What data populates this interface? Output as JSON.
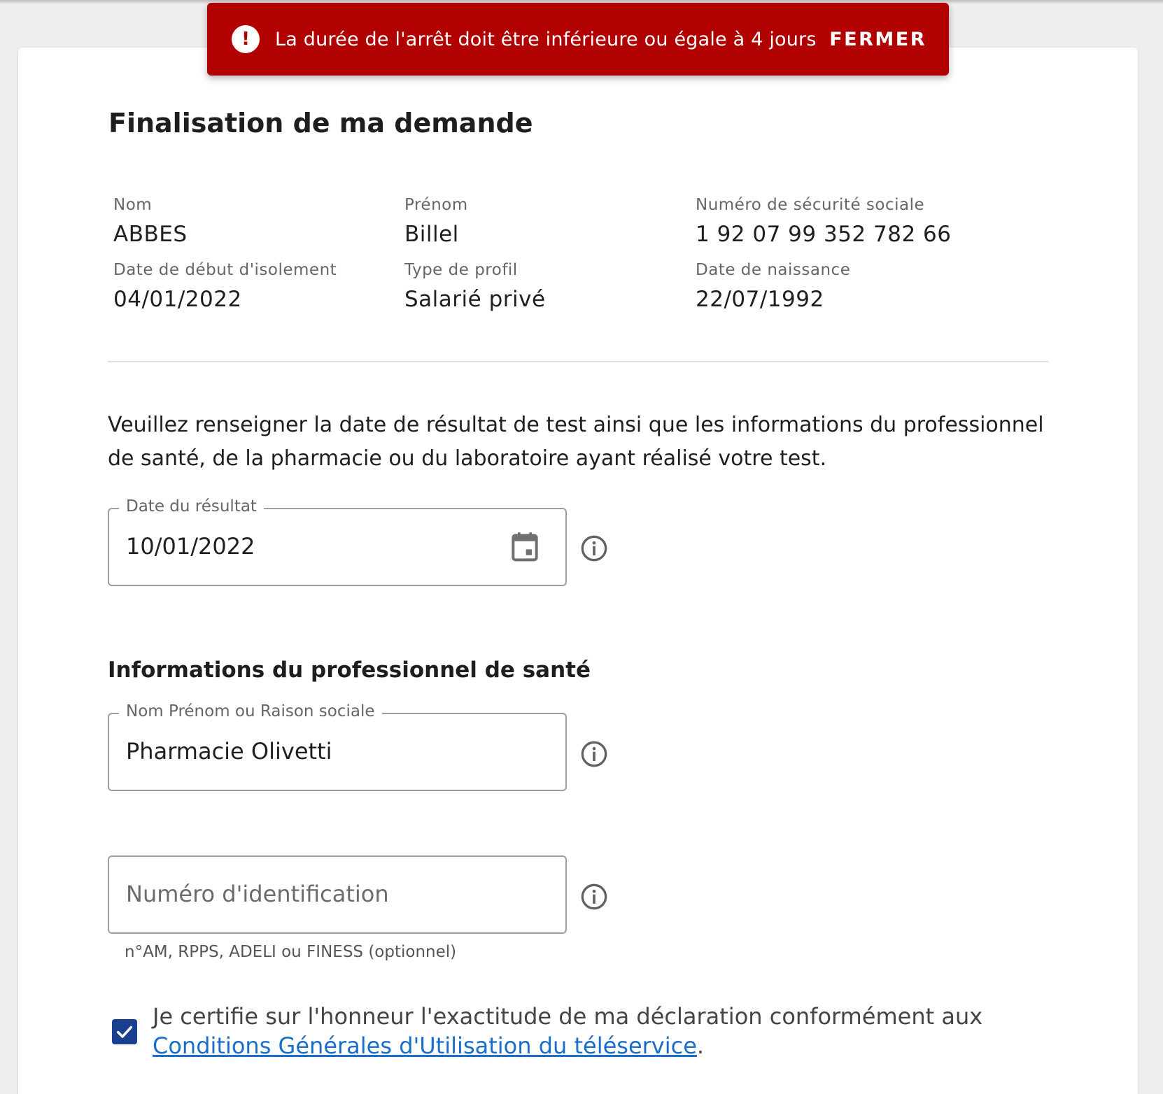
{
  "alert": {
    "message": "La durée de l'arrêt doit être inférieure ou égale à 4 jours",
    "close_label": "FERMER",
    "icon": "exclamation-icon",
    "color": "#b00000"
  },
  "title": "Finalisation de ma demande",
  "person": {
    "nom": {
      "label": "Nom",
      "value": "ABBES"
    },
    "prenom": {
      "label": "Prénom",
      "value": "Billel"
    },
    "nss": {
      "label": "Numéro de sécurité sociale",
      "value": "1 92 07 99 352 782 66"
    },
    "date_debut": {
      "label": "Date de début d'isolement",
      "value": "04/01/2022"
    },
    "profil": {
      "label": "Type de profil",
      "value": "Salarié privé"
    },
    "naissance": {
      "label": "Date de naissance",
      "value": "22/07/1992"
    }
  },
  "intro": "Veuillez renseigner la date de résultat de test ainsi que les informations du professionnel de santé, de la pharmacie ou du laboratoire ayant réalisé votre test.",
  "date_field": {
    "label": "Date du résultat",
    "value": "10/01/2022"
  },
  "section_title": "Informations du professionnel de santé",
  "name_field": {
    "label": "Nom Prénom ou Raison sociale",
    "value": "Pharmacie Olivetti"
  },
  "id_field": {
    "placeholder": "Numéro d'identification",
    "value": "",
    "helper": "n°AM, RPPS, ADELI ou FINESS (optionnel)"
  },
  "certification": {
    "checked": true,
    "text": "Je certifie sur l'honneur l'exactitude de ma déclaration conformément aux ",
    "link": "Conditions Générales d'Utilisation du téléservice",
    "suffix": "."
  },
  "colors": {
    "accent": "#1a3f8f",
    "link": "#1a6ec9",
    "error": "#b00000"
  }
}
